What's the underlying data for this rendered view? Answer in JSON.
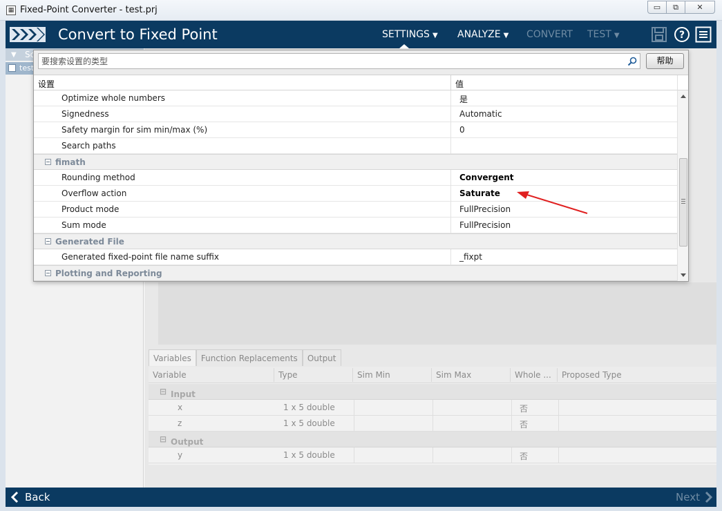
{
  "window": {
    "title": "Fixed-Point Converter - test.prj",
    "minimize": "▭",
    "restore": "⧉",
    "close": "✕"
  },
  "header": {
    "app_title": "Convert to Fixed Point",
    "nav": [
      {
        "label": "SETTINGS",
        "enabled": true,
        "dropdown": true
      },
      {
        "label": "ANALYZE",
        "enabled": true,
        "dropdown": true
      },
      {
        "label": "CONVERT",
        "enabled": false,
        "dropdown": false
      },
      {
        "label": "TEST",
        "enabled": false,
        "dropdown": true
      }
    ],
    "icons": [
      "save-icon",
      "help-icon",
      "menu-icon"
    ],
    "color": "#0b3a61"
  },
  "left_panel": {
    "header": "Sc",
    "item": "test"
  },
  "settings_popup": {
    "search_placeholder": "要搜索设置的类型",
    "help_button": "帮助",
    "columns": {
      "setting": "设置",
      "value": "值"
    },
    "rows": [
      {
        "type": "setting",
        "name": "Optimize whole numbers",
        "value": "是",
        "bold": false
      },
      {
        "type": "setting",
        "name": "Signedness",
        "value": "Automatic",
        "bold": false
      },
      {
        "type": "setting",
        "name": "Safety margin for sim min/max (%)",
        "value": "0",
        "bold": false
      },
      {
        "type": "setting",
        "name": "Search paths",
        "value": "",
        "bold": false
      },
      {
        "type": "group",
        "name": "fimath"
      },
      {
        "type": "setting",
        "name": "Rounding method",
        "value": "Convergent",
        "bold": true
      },
      {
        "type": "setting",
        "name": "Overflow action",
        "value": "Saturate",
        "bold": true
      },
      {
        "type": "setting",
        "name": "Product mode",
        "value": "FullPrecision",
        "bold": false
      },
      {
        "type": "setting",
        "name": "Sum mode",
        "value": "FullPrecision",
        "bold": false
      },
      {
        "type": "group",
        "name": "Generated File"
      },
      {
        "type": "setting",
        "name": "Generated fixed-point file name suffix",
        "value": "_fixpt",
        "bold": false
      },
      {
        "type": "group",
        "name": "Plotting and Reporting"
      }
    ],
    "annotation_color": "#e02020"
  },
  "variables": {
    "tabs": [
      "Variables",
      "Function Replacements",
      "Output"
    ],
    "columns": [
      "Variable",
      "Type",
      "Sim Min",
      "Sim Max",
      "Whole ...",
      "Proposed Type"
    ],
    "groups": [
      {
        "name": "Input",
        "rows": [
          {
            "variable": "x",
            "type": "1 x 5 double",
            "whole": "否"
          },
          {
            "variable": "z",
            "type": "1 x 5 double",
            "whole": "否"
          }
        ]
      },
      {
        "name": "Output",
        "rows": [
          {
            "variable": "y",
            "type": "1 x 5 double",
            "whole": "否"
          }
        ]
      }
    ]
  },
  "footer": {
    "back": "Back",
    "next": "Next"
  }
}
